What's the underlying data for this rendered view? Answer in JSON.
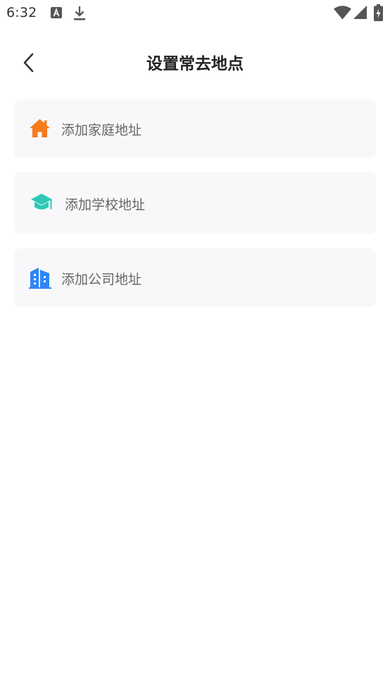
{
  "status_bar": {
    "time": "6:32",
    "icons": [
      "font-notification-icon",
      "download-icon",
      "wifi-icon",
      "signal-icon",
      "battery-charging-icon"
    ]
  },
  "header": {
    "title": "设置常去地点",
    "back_icon": "chevron-left-icon"
  },
  "places": [
    {
      "label": "添加家庭地址",
      "icon": "home-icon",
      "color": "#f57c1f"
    },
    {
      "label": "添加学校地址",
      "icon": "graduation-cap-icon",
      "color": "#2ec9b6"
    },
    {
      "label": "添加公司地址",
      "icon": "building-icon",
      "color": "#2e86f5"
    }
  ]
}
